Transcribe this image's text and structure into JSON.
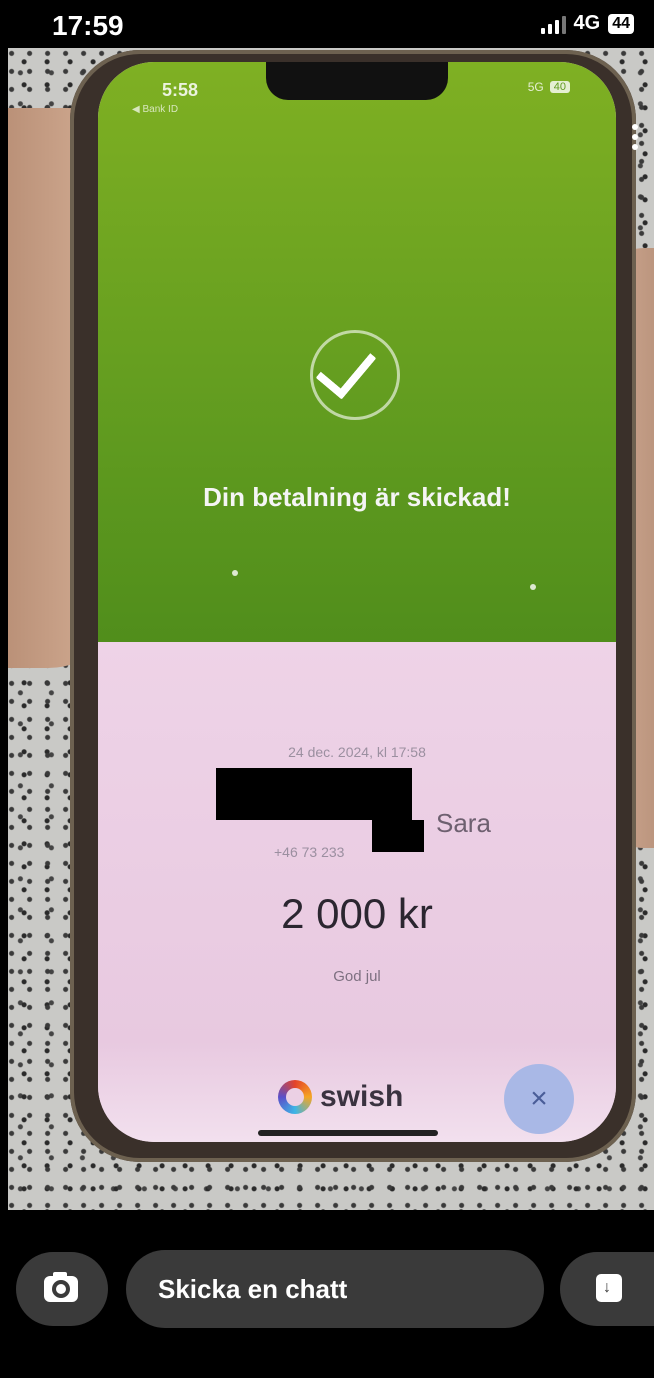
{
  "status_bar": {
    "time": "17:59",
    "network": "4G",
    "battery": "44"
  },
  "phone_screen": {
    "status_time": "5:58",
    "back_label": "◀ Bank ID",
    "network": "5G",
    "battery": "40",
    "success_message": "Din betalning är skickad!",
    "date": "24 dec. 2024, kl 17:58",
    "recipient_name": "Sara",
    "phone_number": "+46 73 233",
    "amount": "2 000 kr",
    "message": "God jul",
    "brand": "swish",
    "close_symbol": "×"
  },
  "chat": {
    "placeholder": "Skicka en chatt"
  },
  "colors": {
    "green_top": "#7fb023",
    "pink_bottom": "#eacfe3",
    "close_button": "#a9b8e6"
  }
}
